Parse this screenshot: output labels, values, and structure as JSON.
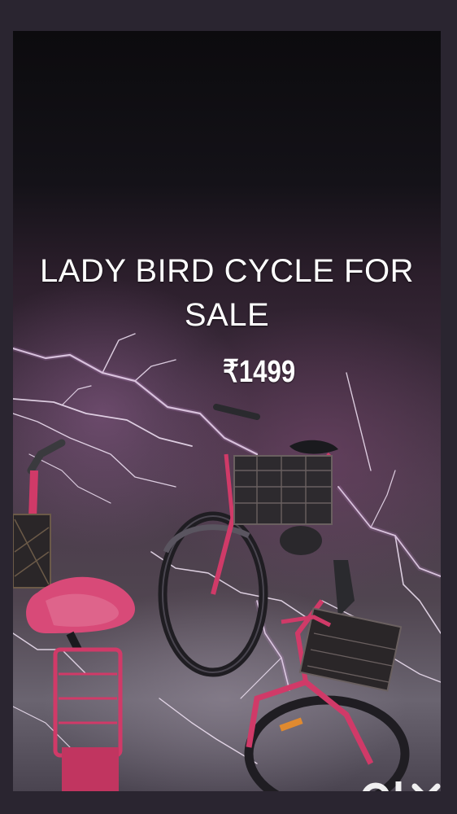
{
  "ad": {
    "headline": "LADY BIRD CYCLE FOR SALE",
    "price": "₹1499"
  },
  "branding": {
    "logo": "OLX",
    "logo_icon": "olx-logo-icon"
  },
  "colors": {
    "background_dark": "#0c0b0e",
    "storm_purple": "#4a3a4a",
    "bike_pink": "#d03a68",
    "text": "#ffffff"
  }
}
